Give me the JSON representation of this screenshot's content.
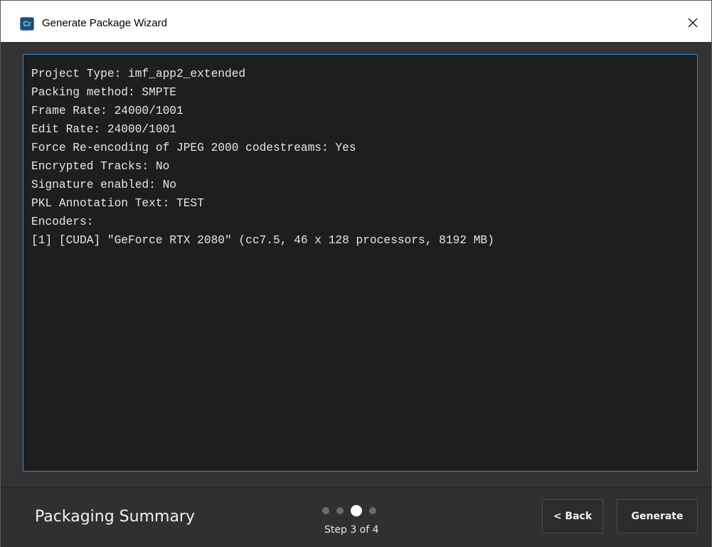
{
  "window": {
    "title": "Generate Package Wizard",
    "app_icon_text": "Cr",
    "close_icon": "close-icon"
  },
  "summary": {
    "lines": [
      "Project Type: imf_app2_extended",
      "Packing method: SMPTE",
      "Frame Rate: 24000/1001",
      "Edit Rate: 24000/1001",
      "Force Re-encoding of JPEG 2000 codestreams: Yes",
      "Encrypted Tracks: No",
      "Signature enabled: No",
      "PKL Annotation Text: TEST",
      "Encoders:",
      "[1] [CUDA] \"GeForce RTX 2080\" (cc7.5, 46 x 128 processors, 8192 MB)"
    ]
  },
  "footer": {
    "page_title": "Packaging Summary",
    "step_label": "Step 3 of 4",
    "current_step": 3,
    "total_steps": 4,
    "back_label": "< Back",
    "generate_label": "Generate"
  },
  "colors": {
    "panel_border": "#2f8ae6",
    "panel_background": "#1e1e1e",
    "window_background": "#333333"
  }
}
